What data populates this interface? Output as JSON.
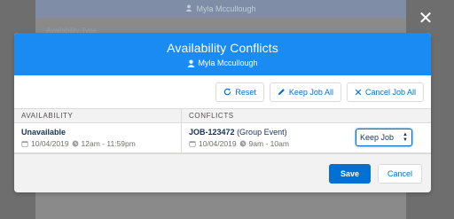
{
  "background": {
    "header_user": "Myla Mccullough",
    "section_label": "Availability Type"
  },
  "modal": {
    "title": "Availability Conflicts",
    "subtitle_user": "Myla Mccullough",
    "toolbar": {
      "reset_label": "Reset",
      "keep_all_label": "Keep Job All",
      "cancel_all_label": "Cancel Job All"
    },
    "table": {
      "headers": [
        "AVAILABILITY",
        "CONFLICTS"
      ],
      "rows": [
        {
          "availability_title": "Unavailable",
          "availability_date": "10/04/2019",
          "availability_time": "12am - 11:59pm",
          "conflict_job": "JOB-123472",
          "conflict_type": "(Group Event)",
          "conflict_date": "10/04/2019",
          "conflict_time": "9am - 10am",
          "action_value": "Keep Job"
        }
      ]
    },
    "footer": {
      "save_label": "Save",
      "cancel_label": "Cancel"
    }
  },
  "colors": {
    "header_blue": "#1b8bf4",
    "brand_blue": "#0070d2",
    "text_dark": "#16325c",
    "text_muted": "#706e6b"
  },
  "icons": {
    "close": "close-icon",
    "user": "user-icon",
    "reset": "refresh-icon",
    "keep_all": "edit-icon",
    "cancel_all": "close-icon",
    "date": "calendar-icon",
    "time": "clock-icon"
  }
}
